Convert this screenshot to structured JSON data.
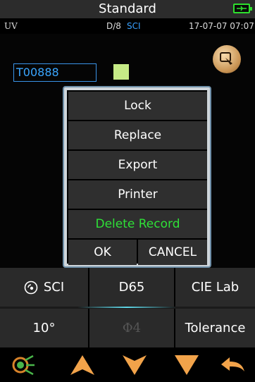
{
  "header": {
    "title": "Standard",
    "battery_icon": "battery-charging-icon"
  },
  "info": {
    "illum_mode": "UV",
    "geometry": "D/8",
    "spec_mode": "SCI",
    "datetime": "17-07-07 07:07"
  },
  "sample": {
    "name": "T00888",
    "swatch_color": "#c6eb86"
  },
  "corner_button": {
    "icon": "edit-tag-icon"
  },
  "dialog": {
    "items": [
      "Lock",
      "Replace",
      "Export",
      "Printer",
      "Delete Record"
    ],
    "ok_label": "OK",
    "cancel_label": "CANCEL",
    "danger_color": "#2fe037"
  },
  "options": {
    "row1": {
      "mode": "SCI",
      "illuminant": "D65",
      "colorspace": "CIE Lab"
    },
    "row2": {
      "observer": "10°",
      "phi": "Φ4",
      "tolerance": "Tolerance"
    }
  },
  "toolbar": {
    "icons": [
      "measure-icon",
      "up-arrow-icon",
      "down-arrow-icon",
      "down-triangle-icon",
      "back-icon"
    ]
  },
  "colors": {
    "accent": "#3aa6ff",
    "header_bg": "#2c2c2c",
    "panel_bg": "#2a2a2a"
  }
}
